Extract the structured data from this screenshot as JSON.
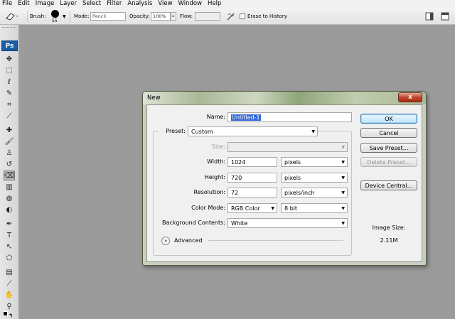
{
  "menubar": [
    "File",
    "Edit",
    "Image",
    "Layer",
    "Select",
    "Filter",
    "Analysis",
    "View",
    "Window",
    "Help"
  ],
  "options": {
    "brush_label": "Brush:",
    "brush_size": "55",
    "mode_label": "Mode:",
    "mode_value": "Pencil",
    "opacity_label": "Opacity:",
    "opacity_value": "100%",
    "flow_label": "Flow:",
    "flow_value": "",
    "erase_history": "Erase to History"
  },
  "toolbox": {
    "logo": "Ps",
    "active_tool": "eraser-tool",
    "tools": [
      "move-tool",
      "marquee-tool",
      "lasso-tool",
      "quick-select-tool",
      "crop-tool",
      "eyedropper-tool",
      "healing-brush-tool",
      "brush-tool",
      "clone-stamp-tool",
      "history-brush-tool",
      "eraser-tool",
      "gradient-tool",
      "blur-tool",
      "dodge-tool",
      "pen-tool",
      "type-tool",
      "path-select-tool",
      "shape-tool",
      "notes-tool",
      "eyedropper-3d-tool",
      "hand-tool",
      "zoom-tool"
    ]
  },
  "dialog": {
    "title": "New",
    "close": "x",
    "name_label": "Name:",
    "name_value": "Untitled-1",
    "preset_label": "Preset:",
    "preset_value": "Custom",
    "size_label": "Size:",
    "size_value": "",
    "width_label": "Width:",
    "width_value": "1024",
    "width_unit": "pixels",
    "height_label": "Height:",
    "height_value": "720",
    "height_unit": "pixels",
    "resolution_label": "Resolution:",
    "resolution_value": "72",
    "resolution_unit": "pixels/inch",
    "color_mode_label": "Color Mode:",
    "color_mode_value": "RGB Color",
    "bit_depth": "8 bit",
    "background_label": "Background Contents:",
    "background_value": "White",
    "advanced_label": "Advanced",
    "buttons": {
      "ok": "OK",
      "cancel": "Cancel",
      "save_preset": "Save Preset...",
      "delete_preset": "Delete Preset...",
      "device_central": "Device Central..."
    },
    "image_size_label": "Image Size:",
    "image_size_value": "2.11M"
  },
  "colors": {
    "accent": "#3367d6",
    "close": "#c1452d",
    "workspace": "#9b9b9b"
  }
}
